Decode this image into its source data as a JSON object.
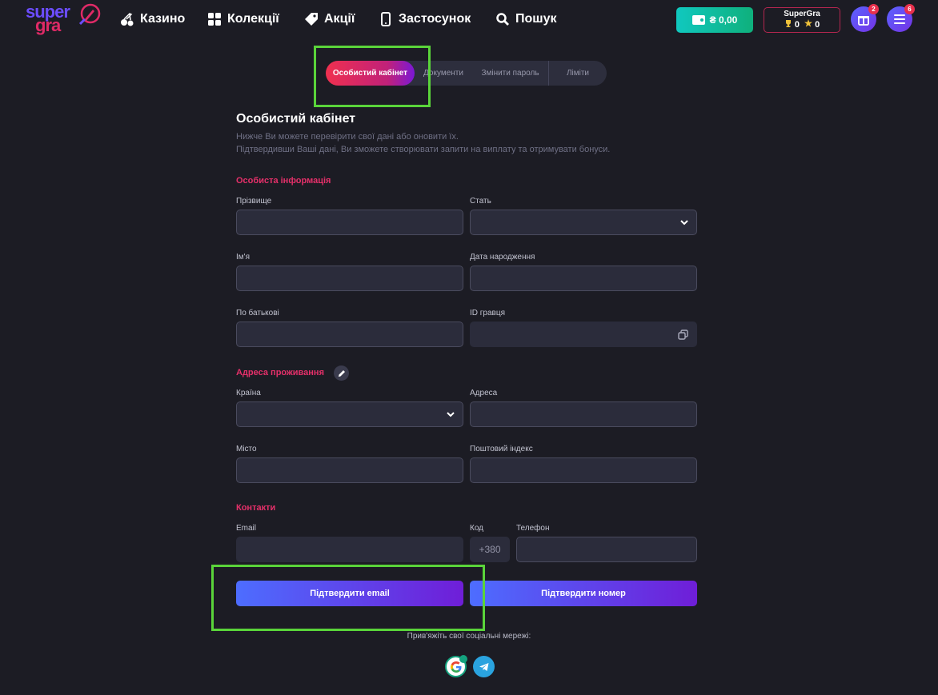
{
  "brand": {
    "line1": "super",
    "line2": "gra"
  },
  "nav": [
    {
      "label": "Казино",
      "icon": "cherry-icon"
    },
    {
      "label": "Колекції",
      "icon": "grid-icon"
    },
    {
      "label": "Акції",
      "icon": "tag-icon"
    },
    {
      "label": "Застосунок",
      "icon": "phone-icon"
    },
    {
      "label": "Пошук",
      "icon": "search-icon"
    }
  ],
  "wallet": {
    "balance": "₴ 0,00"
  },
  "profile": {
    "name": "SuperGra",
    "trophies": "0",
    "stars": "0"
  },
  "gifts": {
    "badge": "2"
  },
  "menu": {
    "badge": "6"
  },
  "tabs": [
    "Особистий кабінет",
    "Документи",
    "Змінити пароль",
    "Ліміти"
  ],
  "page": {
    "title": "Особистий кабінет",
    "desc1": "Нижче Ви можете перевірити свої дані або оновити їх.",
    "desc2": "Підтвердивши Ваші дані, Ви зможете створювати запити на виплату та отримувати бонуси."
  },
  "personal": {
    "heading": "Особиста інформація",
    "surname": "Прізвище",
    "gender": "Стать",
    "name": "Ім'я",
    "birthdate": "Дата народження",
    "patronymic": "По батькові",
    "player_id": "ID гравця"
  },
  "address": {
    "heading": "Адреса проживання",
    "country": "Країна",
    "address": "Адреса",
    "city": "Місто",
    "postcode": "Поштовий індекс"
  },
  "contacts": {
    "heading": "Контакти",
    "email": "Email",
    "code_label": "Код",
    "code_value": "+380",
    "phone": "Телефон"
  },
  "buttons": {
    "confirm_email": "Підтвердити email",
    "confirm_phone": "Підтвердити номер"
  },
  "social": {
    "label": "Прив'яжіть свої соціальні мережі:",
    "networks": [
      "google-icon",
      "telegram-icon"
    ]
  },
  "colors": {
    "accent": "#e6306a",
    "highlight": "#5ad43a",
    "background": "#1c1c24"
  }
}
